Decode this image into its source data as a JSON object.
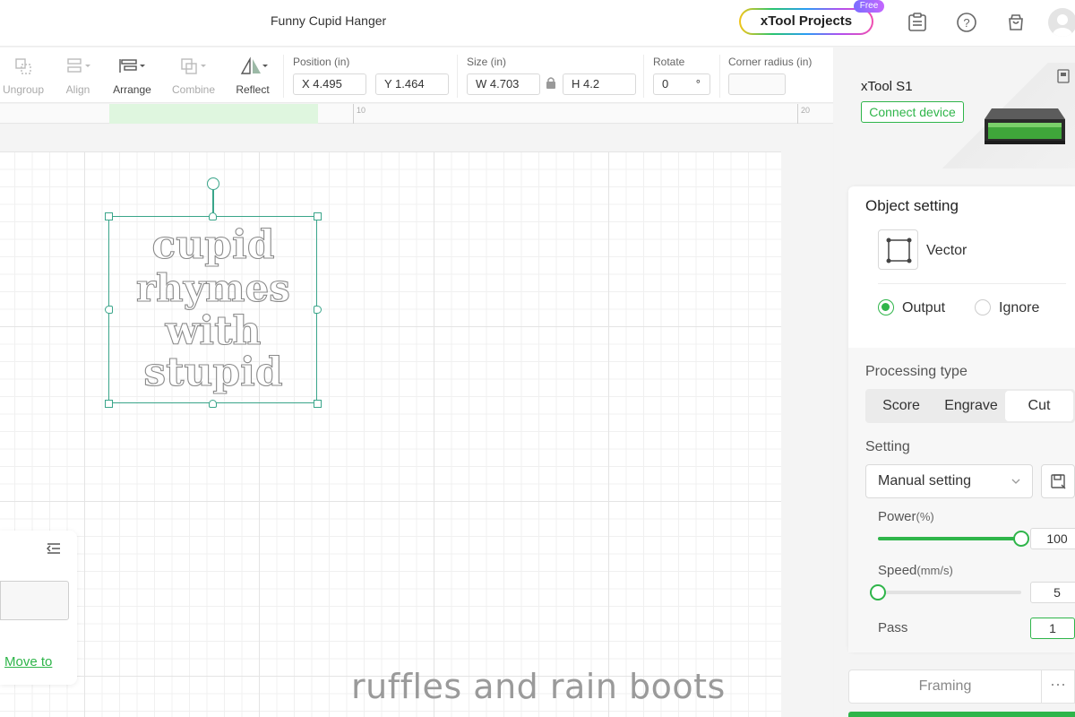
{
  "header": {
    "doc_title": "Funny Cupid Hanger",
    "projects_button": "xTool Projects",
    "free_badge": "Free",
    "icons": [
      "clipboard-icon",
      "help-icon",
      "shop-bag-icon",
      "avatar"
    ]
  },
  "toolbar": {
    "tools": [
      {
        "label": "Ungroup",
        "icon": "ungroup-icon",
        "enabled": false
      },
      {
        "label": "Align",
        "icon": "align-icon",
        "enabled": false
      },
      {
        "label": "Arrange",
        "icon": "arrange-icon",
        "enabled": true
      },
      {
        "label": "Combine",
        "icon": "combine-icon",
        "enabled": false
      },
      {
        "label": "Reflect",
        "icon": "reflect-icon",
        "enabled": true
      }
    ],
    "position_label": "Position (in)",
    "x_value": "X 4.495",
    "y_value": "Y 1.464",
    "size_label": "Size (in)",
    "w_value": "W 4.703",
    "h_value": "H 4.2",
    "rotate_label": "Rotate",
    "rotate_value": "0",
    "rotate_unit": "°",
    "corner_label": "Corner radius (in)",
    "corner_value": ""
  },
  "ruler": {
    "ticks": [
      "10",
      "20"
    ]
  },
  "canvas": {
    "artwork_lines": [
      "cupid",
      "rhymes",
      "with",
      "stupid"
    ]
  },
  "layer_panel": {
    "move_to": "Move to"
  },
  "watermark": "ruffles and rain boots",
  "device": {
    "name": "xTool S1",
    "connect_label": "Connect device"
  },
  "object_setting": {
    "title": "Object setting",
    "type_label": "Vector",
    "output_label": "Output",
    "ignore_label": "Ignore",
    "output_selected": true,
    "processing_type_label": "Processing type",
    "processing_types": [
      "Score",
      "Engrave",
      "Cut"
    ],
    "active_processing_type": "Cut",
    "setting_label": "Setting",
    "setting_value": "Manual setting",
    "power_label": "Power",
    "power_unit": "(%)",
    "power_value": "100",
    "power_fraction": 1.0,
    "speed_label": "Speed",
    "speed_unit": "(mm/s)",
    "speed_value": "5",
    "speed_fraction": 0.0,
    "pass_label": "Pass",
    "pass_value": "1"
  },
  "footer": {
    "framing_label": "Framing",
    "more_label": "···"
  },
  "colors": {
    "accent": "#2fb54a",
    "selection": "#3aa58a"
  }
}
